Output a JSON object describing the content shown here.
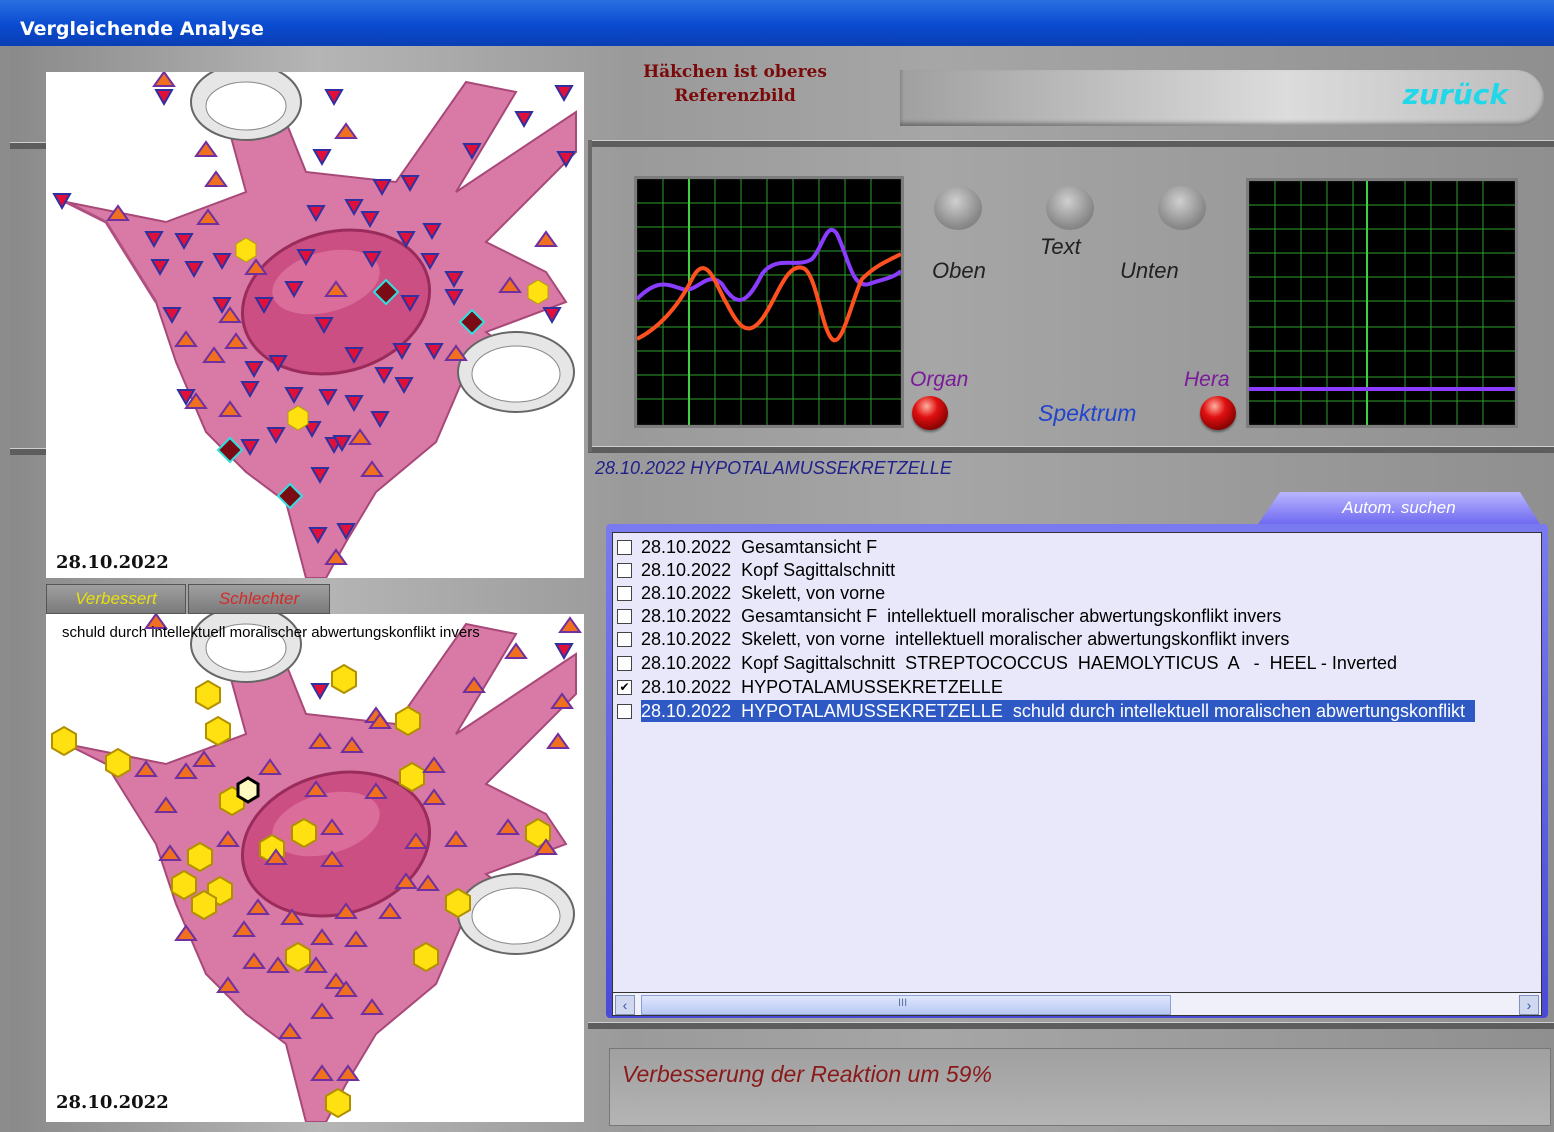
{
  "window": {
    "title": "Vergleichende Analyse"
  },
  "top_panel": {
    "date": "28.10.2022"
  },
  "tabs": {
    "improved": "Verbessert",
    "worse": "Schlechter",
    "improved_color": "#e8e010",
    "worse_color": "#d42a2a"
  },
  "bottom_panel": {
    "caption": "schuld durch intellektuell moralischer abwertungskonflikt invers",
    "date": "28.10.2022"
  },
  "hint": {
    "text": "Häkchen ist oberes Referenzbild"
  },
  "back_button": {
    "label": "zurück"
  },
  "controls": {
    "oben": "Oben",
    "text": "Text",
    "unten": "Unten",
    "organ": "Organ",
    "hera": "Hera",
    "spektrum": "Spektrum"
  },
  "current_item": "28.10.2022 HYPOTALAMUSSEKRETZELLE",
  "auto_search": {
    "label": "Autom. suchen"
  },
  "list": {
    "rows": [
      {
        "checked": false,
        "selected": false,
        "text": "28.10.2022  Gesamtansicht F"
      },
      {
        "checked": false,
        "selected": false,
        "text": "28.10.2022  Kopf Sagittalschnitt"
      },
      {
        "checked": false,
        "selected": false,
        "text": "28.10.2022  Skelett, von vorne"
      },
      {
        "checked": false,
        "selected": false,
        "text": "28.10.2022  Gesamtansicht F  intellektuell moralischer abwertungskonflikt invers"
      },
      {
        "checked": false,
        "selected": false,
        "text": "28.10.2022  Skelett, von vorne  intellektuell moralischer abwertungskonflikt invers"
      },
      {
        "checked": false,
        "selected": false,
        "text": "28.10.2022  Kopf Sagittalschnitt  STREPTOCOCCUS  HAEMOLYTICUS  A   -  HEEL - Inverted"
      },
      {
        "checked": true,
        "selected": false,
        "text": "28.10.2022  HYPOTALAMUSSEKRETZELLE"
      },
      {
        "checked": false,
        "selected": true,
        "text": "28.10.2022  HYPOTALAMUSSEKRETZELLE  schuld durch intellektuell moralischen abwertungskonflikt"
      }
    ],
    "scroll_thumb_text": "III"
  },
  "status": {
    "text": "Verbesserung der Reaktion um 59%"
  }
}
